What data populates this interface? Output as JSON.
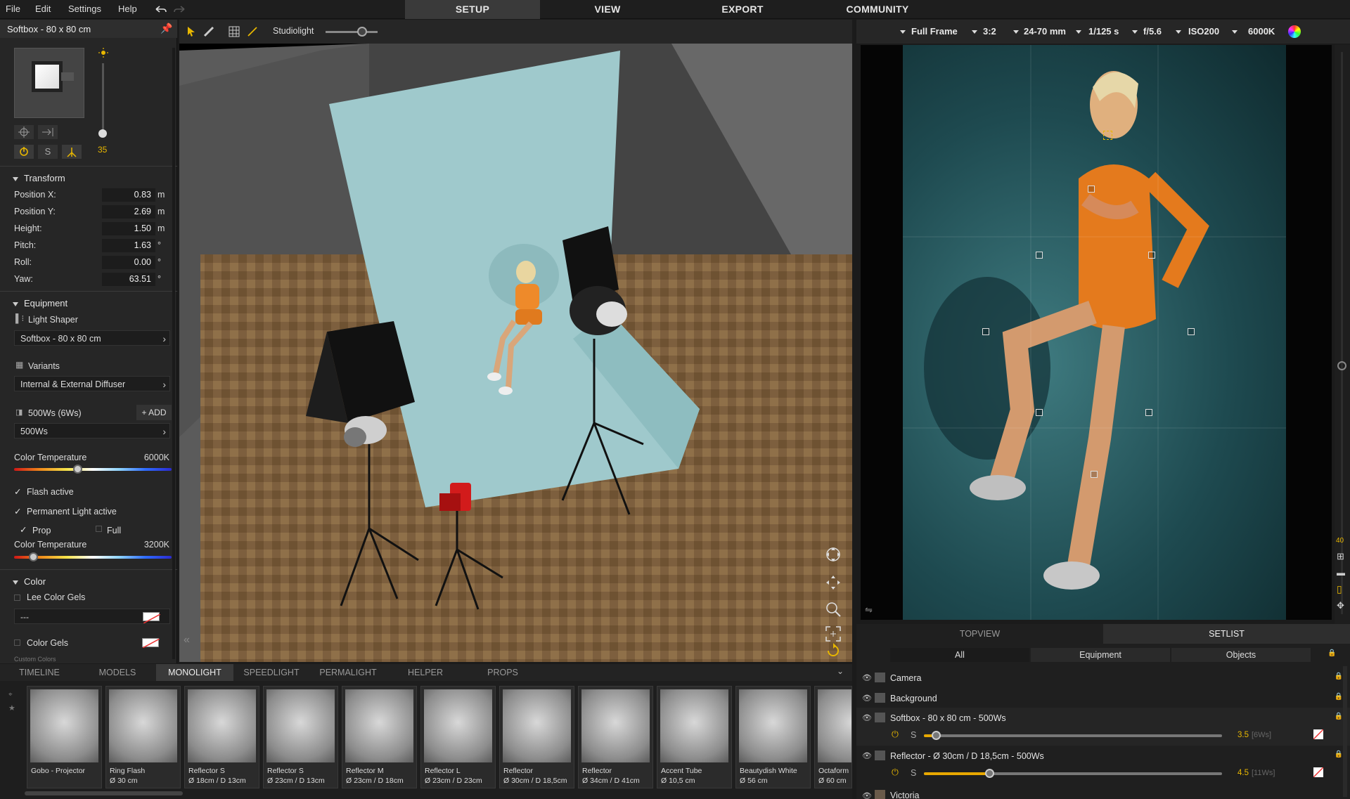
{
  "menu": {
    "file": "File",
    "edit": "Edit",
    "settings": "Settings",
    "help": "Help"
  },
  "topTabs": [
    "SETUP",
    "VIEW",
    "EXPORT",
    "COMMUNITY"
  ],
  "toolbar": {
    "studiolight": "Studiolight"
  },
  "leftPanel": {
    "title": "Softbox - 80 x 80 cm",
    "power": "35",
    "sButton": "S",
    "transform": {
      "header": "Transform",
      "rows": [
        {
          "label": "Position X:",
          "value": "0.83",
          "unit": "m"
        },
        {
          "label": "Position Y:",
          "value": "2.69",
          "unit": "m"
        },
        {
          "label": "Height:",
          "value": "1.50",
          "unit": "m"
        },
        {
          "label": "Pitch:",
          "value": "1.63",
          "unit": "°"
        },
        {
          "label": "Roll:",
          "value": "0.00",
          "unit": "°"
        },
        {
          "label": "Yaw:",
          "value": "63.51",
          "unit": "°"
        }
      ]
    },
    "equipment": {
      "header": "Equipment",
      "shaperLabel": "Light Shaper",
      "shaperValue": "Softbox - 80 x 80 cm",
      "variantsLabel": "Variants",
      "variantsValue": "Internal & External Diffuser",
      "flashLabel": "500Ws (6Ws)",
      "addLabel": "ADD",
      "flashValue": "500Ws",
      "colorTempLabel": "Color Temperature",
      "colorTempValue": "6000K",
      "colorTempLevel": 0.4,
      "flashActive": "Flash active",
      "permLight": "Permanent Light active",
      "prop": "Prop",
      "full": "Full",
      "colorTemp2Label": "Color Temperature",
      "colorTemp2Value": "3200K",
      "colorTemp2Level": 0.12
    },
    "color": {
      "header": "Color",
      "leeGels": "Lee Color Gels",
      "leeValue": "---",
      "colorGels": "Color Gels",
      "customColors": "Custom Colors"
    }
  },
  "camBar": {
    "format": "Full Frame",
    "ratio": "3:2",
    "lens": "24-70 mm",
    "shutter": "1/125 s",
    "aperture": "f/5.6",
    "iso": "ISO200",
    "wb": "6000K"
  },
  "rightStrip": {
    "value": "40"
  },
  "bottomTabs": [
    "TIMELINE",
    "MODELS",
    "MONOLIGHT",
    "SPEEDLIGHT",
    "PERMALIGHT",
    "HELPER",
    "PROPS"
  ],
  "shelf": [
    {
      "name": "Gobo - Projector",
      "sub": ""
    },
    {
      "name": "Ring Flash",
      "sub": "Ø 30 cm"
    },
    {
      "name": "Reflector S",
      "sub": "Ø 18cm / D 13cm"
    },
    {
      "name": "Reflector S",
      "sub": "Ø 23cm / D 13cm"
    },
    {
      "name": "Reflector M",
      "sub": "Ø 23cm / D 18cm"
    },
    {
      "name": "Reflector L",
      "sub": "Ø 23cm / D 23cm"
    },
    {
      "name": "Reflector",
      "sub": "Ø 30cm / D 18,5cm"
    },
    {
      "name": "Reflector",
      "sub": "Ø 34cm / D 41cm"
    },
    {
      "name": "Accent Tube",
      "sub": "Ø 10,5 cm"
    },
    {
      "name": "Beautydish White",
      "sub": "Ø 56 cm"
    },
    {
      "name": "Octaform",
      "sub": "Ø 60 cm"
    }
  ],
  "setPanel": {
    "tabs": [
      "TOPVIEW",
      "SETLIST"
    ],
    "filters": [
      "All",
      "Equipment",
      "Objects"
    ],
    "items": [
      {
        "name": "Camera"
      },
      {
        "name": "Background"
      },
      {
        "name": "Softbox - 80 x 80 cm - 500Ws",
        "s": "S",
        "power": "3.5",
        "ws": "[6Ws]",
        "level": 0.04
      },
      {
        "name": "Reflector - Ø 30cm / D 18,5cm - 500Ws",
        "s": "S",
        "power": "4.5",
        "ws": "[11Ws]",
        "level": 0.22
      },
      {
        "name": "Victoria"
      }
    ]
  },
  "colors": {
    "accent": "#e8b700",
    "panel": "#262626",
    "backdrop": "#9fc9cc"
  }
}
